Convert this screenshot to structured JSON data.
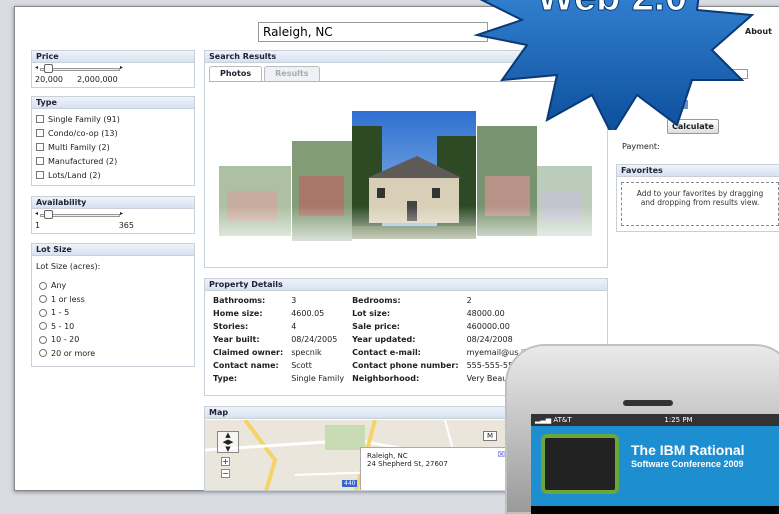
{
  "search": {
    "value": "Raleigh, NC"
  },
  "header": {
    "about": "About",
    "burst_title": "Web 2.0"
  },
  "price": {
    "title": "Price",
    "min": "20,000",
    "max": "2,000,000"
  },
  "type": {
    "title": "Type",
    "items": [
      "Single Family (91)",
      "Condo/co-op (13)",
      "Multi Family (2)",
      "Manufactured (2)",
      "Lots/Land (2)"
    ]
  },
  "availability": {
    "title": "Availability",
    "min": "1",
    "max": "365"
  },
  "lot": {
    "title": "Lot Size",
    "label": "Lot Size (acres):",
    "options": [
      "Any",
      "1 or less",
      "1 - 5",
      "5 - 10",
      "10 - 20",
      "20 or more"
    ]
  },
  "results": {
    "title": "Search Results",
    "tabs": [
      "Photos",
      "Results"
    ]
  },
  "details": {
    "title": "Property Details",
    "rows": [
      [
        "Bathrooms:",
        "3",
        "Bedrooms:",
        "2"
      ],
      [
        "Home size:",
        "4600.05",
        "Lot size:",
        "48000.00"
      ],
      [
        "Stories:",
        "4",
        "Sale price:",
        "460000.00"
      ],
      [
        "Year built:",
        "08/24/2005",
        "Year updated:",
        "08/24/2008"
      ],
      [
        "Claimed owner:",
        "specnik",
        "Contact e-mail:",
        "myemail@us.ibm.com"
      ],
      [
        "Contact name:",
        "Scott",
        "Contact phone number:",
        "555-555-5555"
      ],
      [
        "Type:",
        "Single Family",
        "Neighborhood:",
        "Very Beautiful Nei"
      ]
    ]
  },
  "map": {
    "title": "Map",
    "popup_line1": "Raleigh, NC",
    "popup_line2": "24 Shepherd St, 27607",
    "badge": "440",
    "m_button": "M"
  },
  "calc": {
    "calculate": "Calculate",
    "payment": "Payment:"
  },
  "favorites": {
    "title": "Favorites",
    "hint": "Add to your favorites by dragging and dropping from results view."
  },
  "phone": {
    "carrier": "AT&T",
    "time": "1:25 PM",
    "ad_line1": "The IBM Rational",
    "ad_line2": "Software Conference 2009"
  }
}
